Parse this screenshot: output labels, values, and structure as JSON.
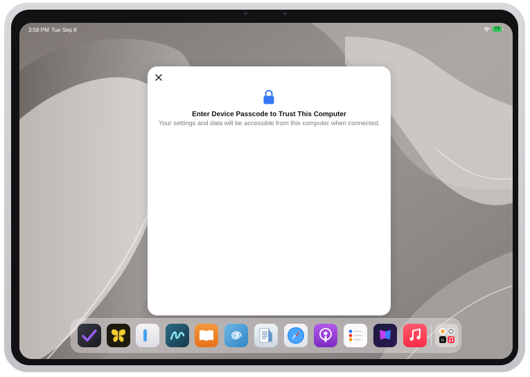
{
  "status_bar": {
    "time": "3:58 PM",
    "date": "Tue Sep 8",
    "battery_level": "73",
    "wifi_icon": "wifi-icon"
  },
  "dialog": {
    "title": "Enter Device Passcode to Trust This Computer",
    "subtitle": "Your settings and data will be accessible from this computer when connected.",
    "close_icon": "close-icon",
    "lock_icon": "lock-icon",
    "lock_color": "#3478f6"
  },
  "dock": {
    "apps": [
      {
        "icon": "omnifocus-app-icon"
      },
      {
        "icon": "tes-butterfly-app-icon"
      },
      {
        "icon": "sidebar-app-icon"
      },
      {
        "icon": "freeform-app-icon"
      },
      {
        "icon": "books-app-icon"
      },
      {
        "icon": "shell-app-icon"
      },
      {
        "icon": "notes-document-app-icon"
      },
      {
        "icon": "safari-app-icon"
      },
      {
        "icon": "podcasts-app-icon"
      },
      {
        "icon": "reminders-app-icon"
      },
      {
        "icon": "craft-butterfly-app-icon"
      },
      {
        "icon": "music-app-icon"
      },
      {
        "icon": "app-library-icon"
      }
    ],
    "app_library": {
      "tv_label": "tv"
    }
  }
}
